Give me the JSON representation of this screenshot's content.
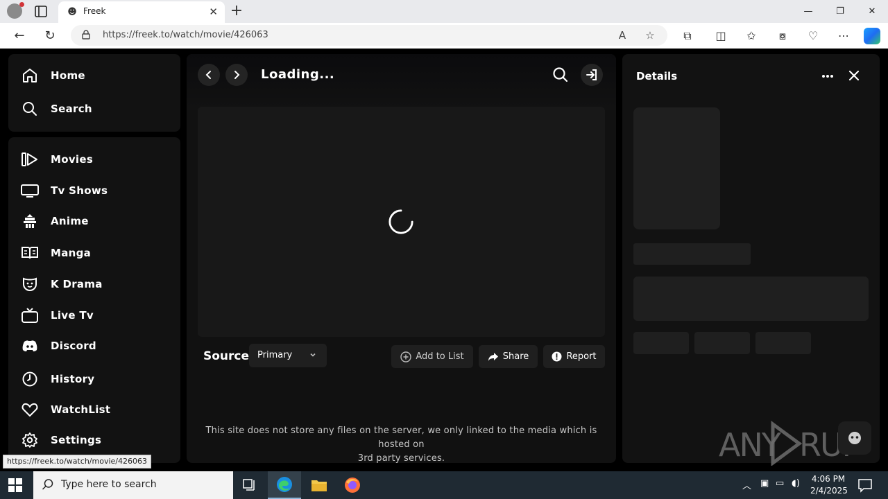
{
  "browser": {
    "tab_title": "Freek",
    "url": "https://freek.to/watch/movie/426063",
    "status_url": "https://freek.to/watch/movie/426063"
  },
  "sidebar": {
    "top": [
      {
        "label": "Home",
        "icon": "home-icon"
      },
      {
        "label": "Search",
        "icon": "search-icon"
      }
    ],
    "items": [
      {
        "label": "Movies",
        "icon": "movie-play-icon"
      },
      {
        "label": "Tv Shows",
        "icon": "tv-icon"
      },
      {
        "label": "Anime",
        "icon": "anime-icon"
      },
      {
        "label": "Manga",
        "icon": "book-icon"
      },
      {
        "label": "K Drama",
        "icon": "mask-icon"
      },
      {
        "label": "Live Tv",
        "icon": "live-tv-icon"
      },
      {
        "label": "Discord",
        "icon": "discord-icon"
      },
      {
        "label": "History",
        "icon": "clock-icon"
      },
      {
        "label": "WatchList",
        "icon": "heart-icon"
      },
      {
        "label": "Settings",
        "icon": "gear-icon"
      }
    ]
  },
  "main": {
    "title": "Loading...",
    "source_label": "Source",
    "source_value": "Primary",
    "actions": {
      "add_to_list": "Add to List",
      "share": "Share",
      "report": "Report"
    },
    "disclaimer_line1": "This site does not store any files on the server, we only linked to the media which is hosted on",
    "disclaimer_line2": "3rd party services."
  },
  "details": {
    "title": "Details"
  },
  "watermark": {
    "text": "ANY RUN"
  },
  "taskbar": {
    "search_placeholder": "Type here to search",
    "time": "4:06 PM",
    "date": "2/4/2025"
  },
  "colors": {
    "panel": "#121212",
    "skeleton": "#1f1f1f",
    "taskbar": "#1f2a33"
  }
}
